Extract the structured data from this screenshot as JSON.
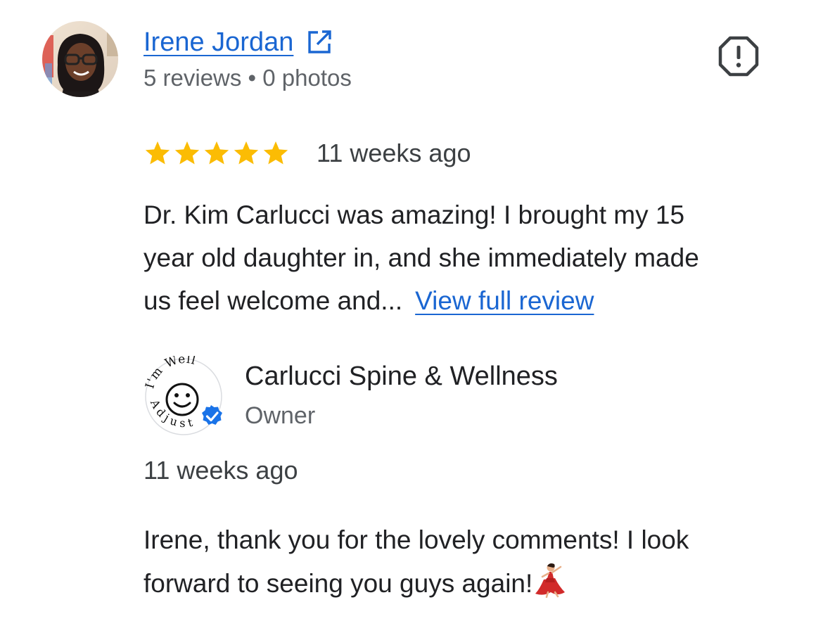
{
  "review": {
    "reviewer_name": "Irene Jordan",
    "reviewer_meta": "5 reviews • 0 photos",
    "rating": 5,
    "rating_max": 5,
    "age": "11 weeks ago",
    "text_lines": [
      "Dr. Kim Carlucci was amazing! I brought my 15",
      "year old daughter in, and she immediately made",
      "us feel welcome and..."
    ],
    "view_full_label": "View full review",
    "icons": {
      "external_link": "external-link-icon",
      "report": "report-flag-icon",
      "star": "star-icon",
      "star_color": "#fbbc04"
    }
  },
  "owner_reply": {
    "business_name": "Carlucci Spine & Wellness",
    "role": "Owner",
    "age": "11 weeks ago",
    "logo_text_top": "I'm Well",
    "logo_text_bottom": "Adjust",
    "text_lines": [
      "Irene, thank you for the lovely comments! I look",
      "forward to seeing you guys again!"
    ],
    "emoji": "dancer-emoji",
    "verified_color": "#1a73e8"
  },
  "colors": {
    "link": "#1a66d2",
    "text": "#202124",
    "secondary_text": "#5f6368"
  }
}
